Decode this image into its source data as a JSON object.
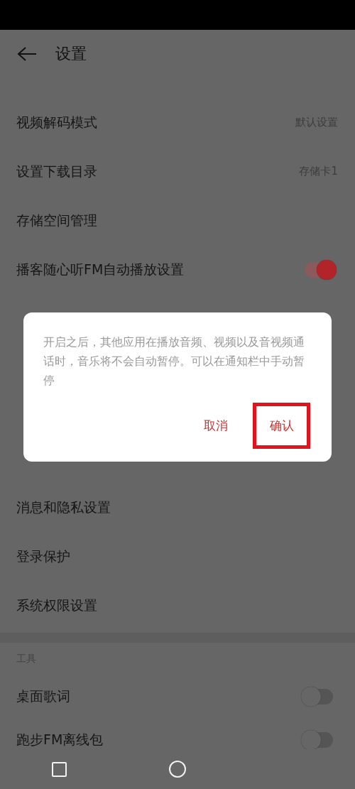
{
  "header": {
    "title": "设置"
  },
  "sections": [
    {
      "rows": [
        {
          "kind": "value",
          "label": "视频解码模式",
          "value": "默认设置"
        },
        {
          "kind": "value",
          "label": "设置下载目录",
          "value": "存储卡1"
        },
        {
          "kind": "plain",
          "label": "存储空间管理"
        },
        {
          "kind": "toggle",
          "label": "播客随心听FM自动播放设置",
          "on": true
        }
      ]
    },
    {
      "rows": [
        {
          "kind": "plain",
          "label": "消息和隐私设置"
        },
        {
          "kind": "plain",
          "label": "登录保护"
        },
        {
          "kind": "plain",
          "label": "系统权限设置"
        }
      ]
    },
    {
      "title": "工具",
      "rows": [
        {
          "kind": "toggle",
          "label": "桌面歌词",
          "on": false
        },
        {
          "kind": "toggle",
          "label": "跑步FM离线包",
          "on": false
        }
      ]
    }
  ],
  "dialog": {
    "message": "开启之后，其他应用在播放音频、视频以及音视频通话时，音乐将不会自动暂停。可以在通知栏中手动暂停",
    "buttons": [
      {
        "label": "取消",
        "highlighted": false
      },
      {
        "label": "确认",
        "highlighted": true
      }
    ]
  }
}
